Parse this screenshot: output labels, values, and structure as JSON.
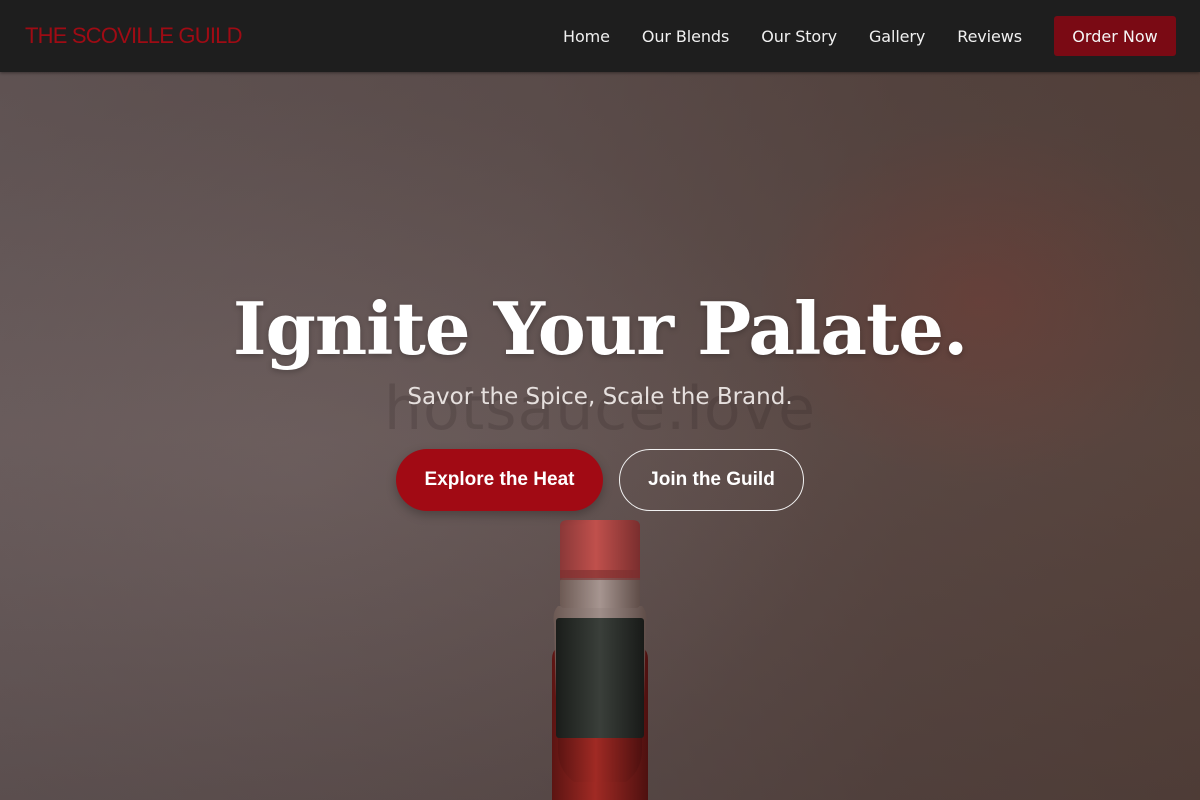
{
  "nav": {
    "brand": "THE SCOVILLE GUILD",
    "links": [
      "Home",
      "Our Blends",
      "Our Story",
      "Gallery",
      "Reviews"
    ],
    "cta_label": "Order Now"
  },
  "hero": {
    "headline": "Ignite Your Palate.",
    "subheadline": "Savor the Spice, Scale the Brand.",
    "watermark": "hotsauce.love",
    "primary_cta": "Explore the Heat",
    "secondary_cta": "Join the Guild",
    "background_image": "hot-sauce-bottle"
  },
  "colors": {
    "brand_red": "#9f0b14",
    "order_button": "#7a0a14",
    "primary_cta": "#a10a14",
    "navbar_bg": "#1e1e1e"
  }
}
